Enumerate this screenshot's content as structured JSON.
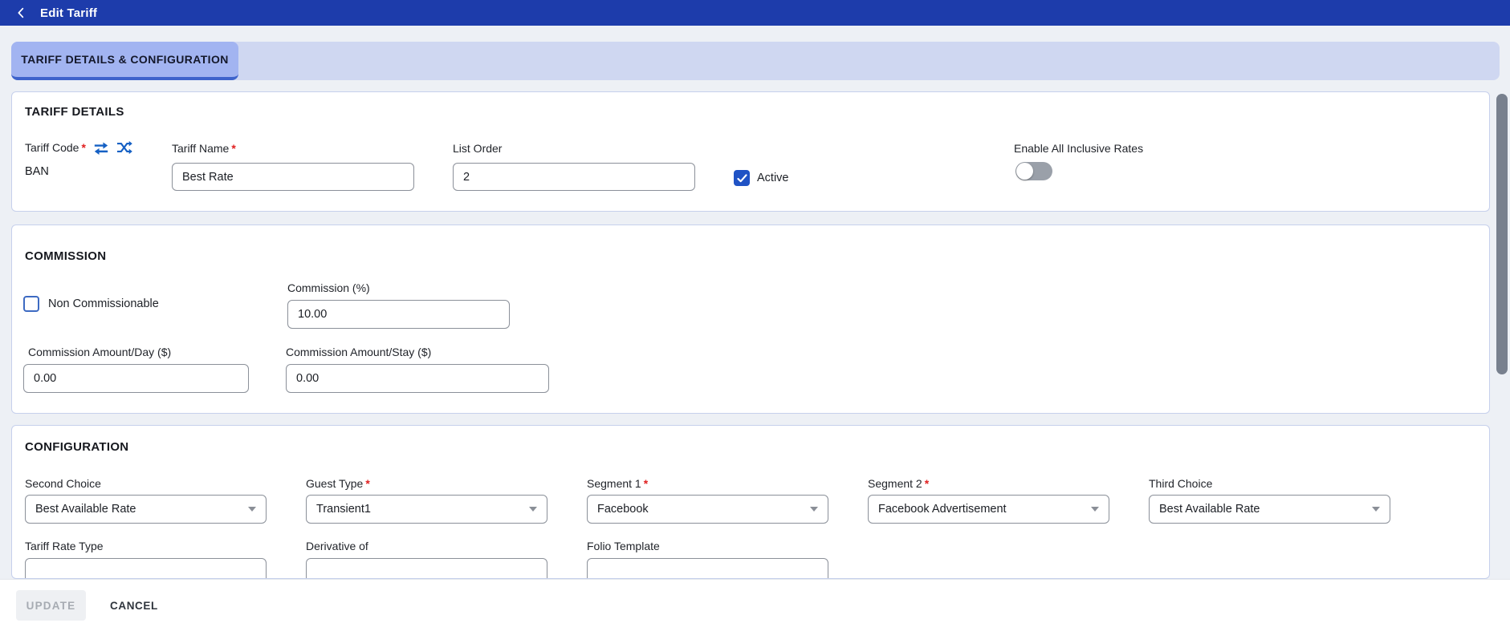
{
  "header": {
    "title": "Edit Tariff"
  },
  "tabs": [
    {
      "label": "TARIFF DETAILS & CONFIGURATION",
      "active": true
    }
  ],
  "tariff_details": {
    "title": "TARIFF DETAILS",
    "tariff_code": {
      "label": "Tariff Code",
      "required_mark": "*",
      "value": "BAN"
    },
    "tariff_name": {
      "label": "Tariff Name",
      "required_mark": "*",
      "value": "Best Rate"
    },
    "list_order": {
      "label": "List Order",
      "value": "2"
    },
    "active": {
      "label": "Active",
      "checked": true
    },
    "all_inclusive": {
      "label": "Enable All Inclusive Rates",
      "enabled": false
    }
  },
  "commission": {
    "title": "COMMISSION",
    "non_commissionable": {
      "label": "Non Commissionable",
      "checked": false
    },
    "pct": {
      "label": "Commission (%)",
      "value": "10.00"
    },
    "per_day": {
      "label": "Commission Amount/Day ($)",
      "value": "0.00"
    },
    "per_stay": {
      "label": "Commission Amount/Stay ($)",
      "value": "0.00"
    }
  },
  "configuration": {
    "title": "CONFIGURATION",
    "fields": [
      {
        "label": "Second Choice",
        "value": "Best Available Rate"
      },
      {
        "label": "Guest Type",
        "required_mark": "*",
        "value": "Transient1"
      },
      {
        "label": "Segment 1",
        "required_mark": "*",
        "value": "Facebook"
      },
      {
        "label": "Segment 2",
        "required_mark": "*",
        "value": "Facebook Advertisement"
      },
      {
        "label": "Third Choice",
        "value": "Best Available Rate"
      }
    ],
    "row2": [
      {
        "label": "Tariff Rate Type"
      },
      {
        "label": "Derivative of"
      },
      {
        "label": "Folio Template"
      }
    ]
  },
  "footer": {
    "update_label": "UPDATE",
    "cancel_label": "CANCEL"
  },
  "colors": {
    "header_bg": "#1d3cab",
    "tab_active_bg": "#a2b4f1",
    "tab_bar_bg": "#cfd7f1",
    "tab_underline": "#3e63cb",
    "accent_blue": "#2053c5",
    "icon_blue": "#1560c4",
    "required_red": "#e02020"
  }
}
